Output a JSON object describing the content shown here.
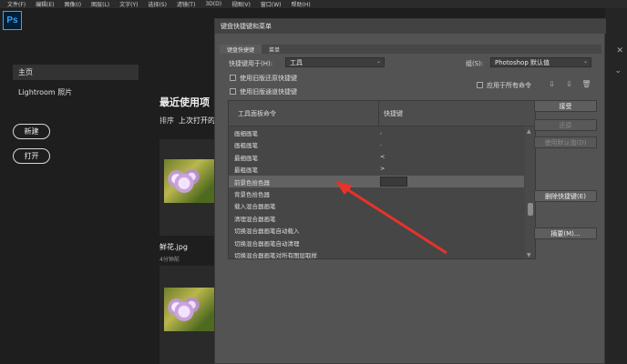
{
  "menubar": [
    "文件(F)",
    "编辑(E)",
    "图像(I)",
    "图层(L)",
    "文字(Y)",
    "选择(S)",
    "滤镜(T)",
    "3D(D)",
    "视图(V)",
    "窗口(W)",
    "帮助(H)"
  ],
  "app": {
    "logo": "Ps"
  },
  "nav": {
    "home": "主页",
    "lightroom": "Lightroom 照片",
    "new_button": "新建",
    "open_button": "打开"
  },
  "recent": {
    "title": "最近使用项",
    "sort_label": "排序",
    "sort_value": "上次打开的",
    "file_name": "鲜花.jpg",
    "file_time": "4分钟前"
  },
  "dialog": {
    "title": "键盘快捷键和菜单",
    "tabs": [
      "键盘快捷键",
      "菜单"
    ],
    "shortcuts_for_label": "快捷键用于(H):",
    "shortcuts_for_value": "工具",
    "set_label": "组(S):",
    "set_value": "Photoshop 默认值",
    "check_legacy_undo": "使用旧版还原快捷键",
    "check_legacy_channel": "使用旧版通道快捷键",
    "check_apply_all": "应用于所有命令",
    "table_header_command": "工具面板命令",
    "table_header_shortcut": "快捷键",
    "rows": [
      {
        "command": "画细画笔",
        "shortcut": ","
      },
      {
        "command": "画粗画笔",
        "shortcut": "."
      },
      {
        "command": "最细画笔",
        "shortcut": "<"
      },
      {
        "command": "最粗画笔",
        "shortcut": ">"
      },
      {
        "command": "前景色拾色器",
        "shortcut": ""
      },
      {
        "command": "背景色拾色器",
        "shortcut": ""
      },
      {
        "command": "载入混合器画笔",
        "shortcut": ""
      },
      {
        "command": "清理混合器画笔",
        "shortcut": ""
      },
      {
        "command": "切换混合器画笔自动载入",
        "shortcut": ""
      },
      {
        "command": "切换混合器画笔自动清理",
        "shortcut": ""
      },
      {
        "command": "切换混合器画笔对所有图层取样",
        "shortcut": ""
      }
    ],
    "selected_row": 4,
    "buttons": {
      "accept": "接受",
      "undo": "还原",
      "use_default": "使用默认值(D)",
      "delete": "删除快捷键(E)",
      "summarize": "摘要(M)..."
    }
  },
  "colors": {
    "arrow": "#e8322b",
    "ps_accent": "#31a8ff"
  }
}
